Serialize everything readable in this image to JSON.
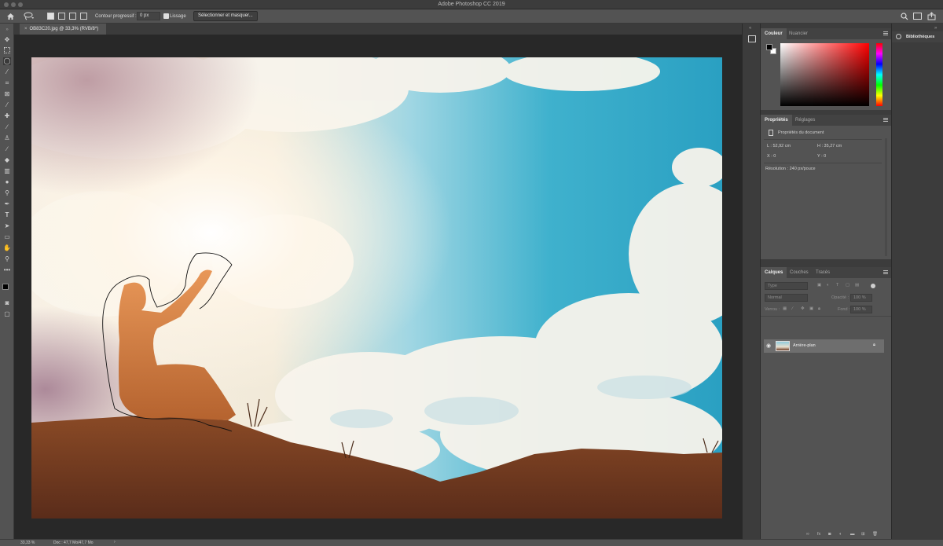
{
  "app": {
    "window_title": "Adobe Photoshop CC 2019"
  },
  "options_bar": {
    "feather_label": "Contour progressif :",
    "feather_value": "0 px",
    "antialias_label": "Lissage",
    "select_mask_label": "Sélectionner et masquer..."
  },
  "document": {
    "tab_label": "OB83C20.jpg @ 33,3% (RVB/8*)"
  },
  "status": {
    "zoom": "33,33 %",
    "doc_info": "Doc : 47,7 Mo/47,7 Mo"
  },
  "color_panel": {
    "tabs": [
      "Couleur",
      "Nuancier"
    ],
    "foreground": "#000000",
    "background": "#ffffff",
    "hue_color": "#ff0000"
  },
  "properties_panel": {
    "tabs": [
      "Propriétés",
      "Réglages"
    ],
    "section_title": "Propriétés du document",
    "width_label": "L : 52,92 cm",
    "height_label": "H : 35,27 cm",
    "x_label": "X : 0",
    "y_label": "Y : 0",
    "resolution": "Résolution : 240 px/pouce"
  },
  "layers_panel": {
    "tabs": [
      "Calques",
      "Couches",
      "Tracés"
    ],
    "filter_placeholder": "Type",
    "blend_mode": "Normal",
    "opacity_label": "Opacité :",
    "opacity_value": "100 %",
    "lock_label": "Verrou :",
    "fill_label": "Fond :",
    "fill_value": "100 %",
    "layers": [
      {
        "name": "Arrière-plan",
        "visible": true,
        "locked": true
      }
    ]
  },
  "libraries": {
    "label": "Bibliothèques"
  }
}
